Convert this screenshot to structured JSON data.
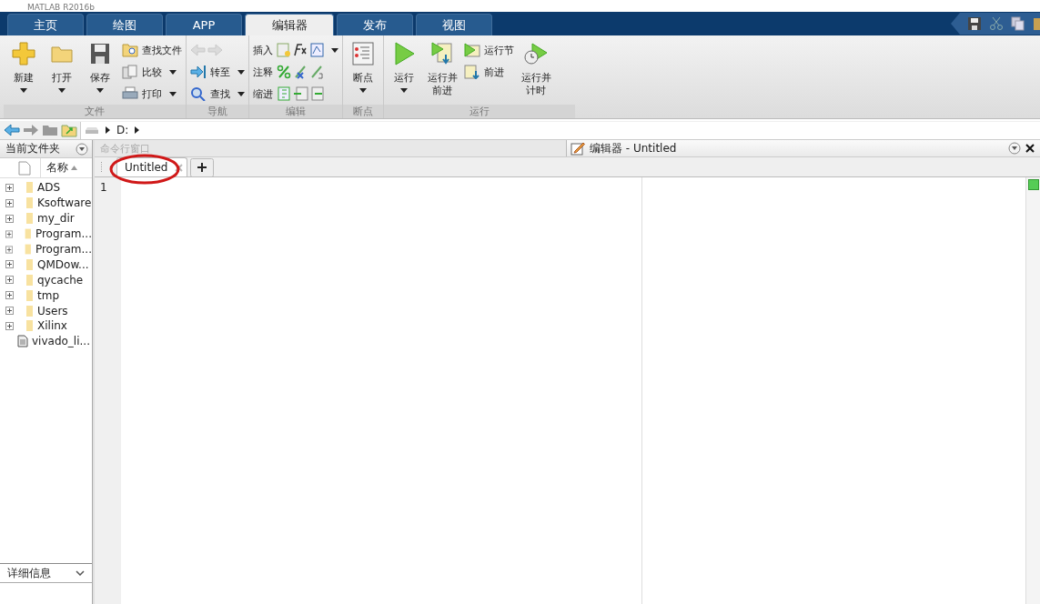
{
  "window": {
    "title": "MATLAB R2016b"
  },
  "tabs": [
    {
      "label": "主页",
      "selected": false
    },
    {
      "label": "绘图",
      "selected": false
    },
    {
      "label": "APP",
      "selected": false
    },
    {
      "label": "编辑器",
      "selected": true
    },
    {
      "label": "发布",
      "selected": false
    },
    {
      "label": "视图",
      "selected": false
    }
  ],
  "ribbon": {
    "groups": [
      {
        "label": "文件",
        "items": [
          {
            "kind": "large",
            "label": "新建",
            "dropdown": true
          },
          {
            "kind": "large",
            "label": "打开",
            "dropdown": true
          },
          {
            "kind": "large",
            "label": "保存",
            "dropdown": true
          },
          {
            "kind": "stack",
            "rows": [
              {
                "label": "查找文件",
                "dropdown": false,
                "disabled": false
              },
              {
                "label": "比较",
                "dropdown": true,
                "disabled": false
              },
              {
                "label": "打印",
                "dropdown": true,
                "disabled": false
              }
            ]
          }
        ]
      },
      {
        "label": "导航",
        "items": [
          {
            "kind": "stack",
            "rows": [
              {
                "disabled": true,
                "dropdown": false
              },
              {
                "label": "转至",
                "dropdown": true,
                "disabled": false
              },
              {
                "label": "查找",
                "dropdown": true,
                "disabled": false
              }
            ]
          }
        ]
      },
      {
        "label": "编辑",
        "items": [
          {
            "kind": "stack",
            "rows": [
              {
                "label": "插入",
                "dropdown": true,
                "disabled": false
              },
              {
                "label": "注释",
                "dropdown": false,
                "disabled": false
              },
              {
                "label": "缩进",
                "dropdown": false,
                "disabled": false
              }
            ]
          }
        ]
      },
      {
        "label": "断点",
        "items": [
          {
            "kind": "large",
            "label": "断点",
            "dropdown": true
          }
        ]
      },
      {
        "label": "运行",
        "items": [
          {
            "kind": "large",
            "label": "运行",
            "dropdown": true
          },
          {
            "kind": "large",
            "label": "运行并前进",
            "dropdown": false
          },
          {
            "kind": "stack",
            "rows": [
              {
                "label": "运行节",
                "dropdown": false,
                "disabled": false
              },
              {
                "label": "前进",
                "dropdown": false,
                "disabled": false
              }
            ]
          },
          {
            "kind": "large",
            "label": "运行并计时",
            "dropdown": false
          }
        ]
      }
    ]
  },
  "address_bar": {
    "segments": [
      "D:"
    ]
  },
  "file_browser": {
    "title": "当前文件夹",
    "column": "名称",
    "items": [
      {
        "name": "ADS",
        "kind": "folder"
      },
      {
        "name": "Ksoftware",
        "kind": "folder"
      },
      {
        "name": "my_dir",
        "kind": "folder"
      },
      {
        "name": "Program...",
        "kind": "folder"
      },
      {
        "name": "Program...",
        "kind": "folder"
      },
      {
        "name": "QMDow...",
        "kind": "folder"
      },
      {
        "name": "qycache",
        "kind": "folder"
      },
      {
        "name": "tmp",
        "kind": "folder"
      },
      {
        "name": "Users",
        "kind": "folder"
      },
      {
        "name": "Xilinx",
        "kind": "folder"
      },
      {
        "name": "vivado_li...",
        "kind": "file"
      }
    ],
    "details": "详细信息"
  },
  "command_window": {
    "title": "命令行窗口"
  },
  "editor": {
    "title": "编辑器 - Untitled",
    "tabs": [
      {
        "label": "Untitled",
        "selected": true
      }
    ],
    "line_numbers": [
      "1"
    ]
  }
}
